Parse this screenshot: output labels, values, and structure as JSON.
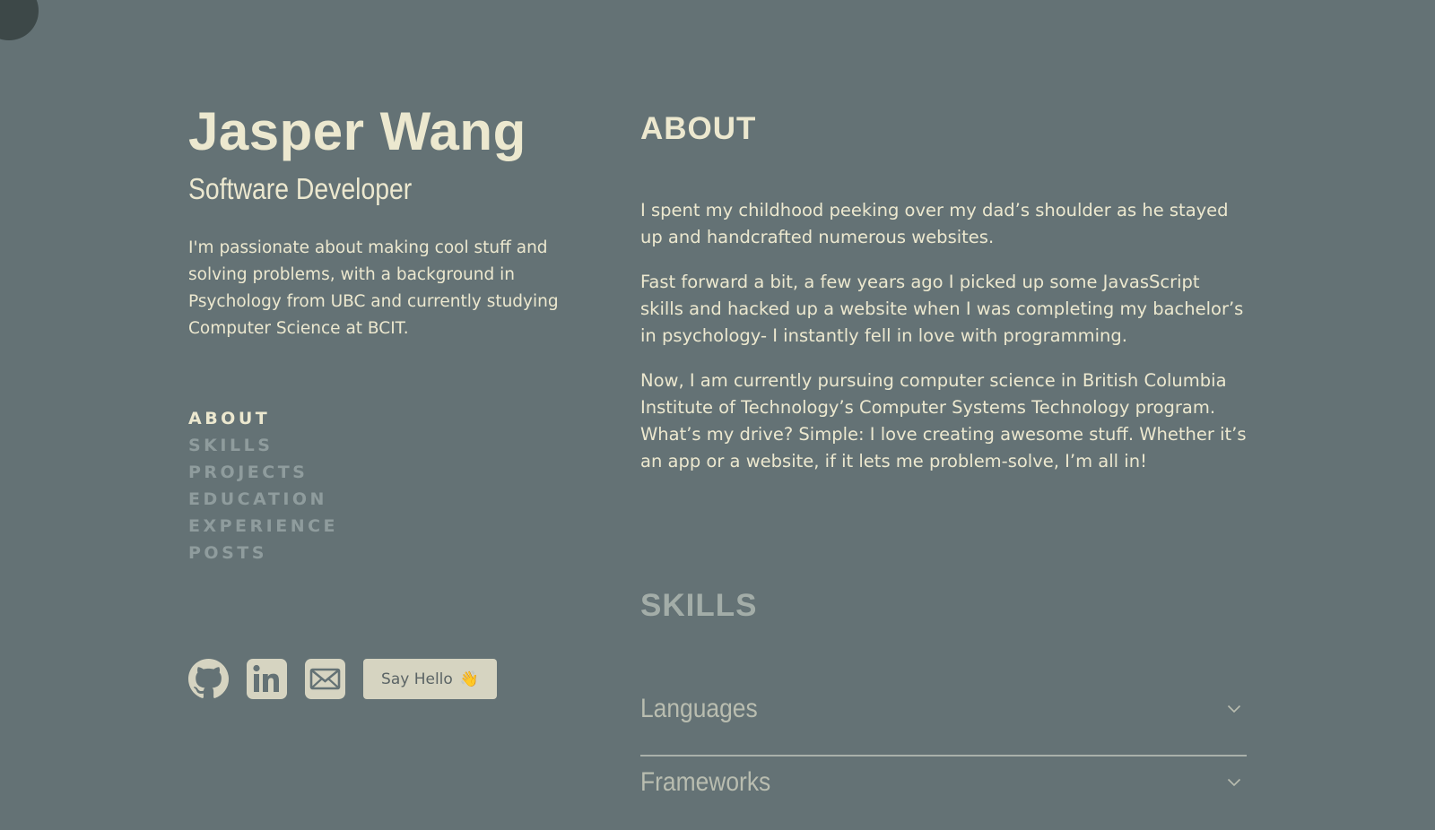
{
  "profile": {
    "name": "Jasper Wang",
    "role": "Software Developer",
    "intro": "I'm passionate about making cool stuff and solving problems, with a background in Psychology from UBC and currently studying Computer Science at BCIT."
  },
  "nav": {
    "items": [
      {
        "label": "ABOUT",
        "active": true
      },
      {
        "label": "SKILLS",
        "active": false
      },
      {
        "label": "PROJECTS",
        "active": false
      },
      {
        "label": "EDUCATION",
        "active": false
      },
      {
        "label": "EXPERIENCE",
        "active": false
      },
      {
        "label": "POSTS",
        "active": false
      }
    ]
  },
  "socials": {
    "icons": [
      "github-icon",
      "linkedin-icon",
      "mail-icon"
    ],
    "hello_label": "Say Hello",
    "hello_emoji": "👋"
  },
  "about": {
    "title": "ABOUT",
    "paragraphs": [
      "I spent my childhood peeking over my dad’s shoulder as he stayed up and handcrafted numerous websites.",
      "Fast forward a bit, a few years ago I picked up some JavasScript skills and hacked up a website when I was completing my bachelor’s in psychology- I instantly fell in love with programming.",
      "Now, I am currently pursuing computer science in British Columbia Institute of Technology’s Computer Systems Technology program. What’s my drive? Simple: I love creating awesome stuff. Whether it’s an app or a website, if it lets me problem-solve, I’m all in!"
    ]
  },
  "skills": {
    "title": "SKILLS",
    "categories": [
      {
        "label": "Languages",
        "expanded": false
      },
      {
        "label": "Frameworks",
        "expanded": false
      }
    ]
  },
  "colors": {
    "background": "#647275",
    "text": "#ece8cf",
    "muted": "#8f9c9d",
    "button_bg": "#d6d4c1"
  }
}
